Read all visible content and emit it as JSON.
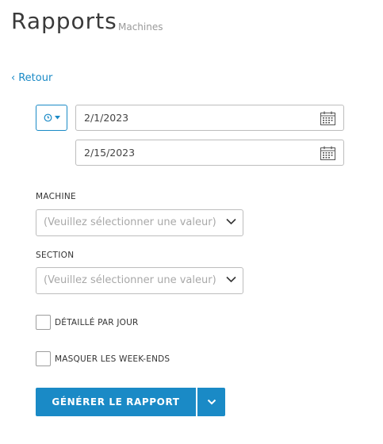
{
  "header": {
    "title": "Rapports",
    "subtitle": "Machines"
  },
  "nav": {
    "back_label": "Retour"
  },
  "date_range": {
    "start_date": "2/1/2023",
    "end_date": "2/15/2023"
  },
  "machine": {
    "label": "MACHINE",
    "placeholder": "(Veuillez sélectionner une valeur)"
  },
  "section": {
    "label": "SECTION",
    "placeholder": "(Veuillez sélectionner une valeur)"
  },
  "options": {
    "detail_by_day_label": "DÉTAILLÉ PAR JOUR",
    "hide_weekends_label": "MASQUER LES WEEK-ENDS"
  },
  "actions": {
    "generate_label": "GÉNÉRER LE RAPPORT"
  },
  "colors": {
    "accent": "#1a8ac6",
    "border": "#bdbdbd",
    "placeholder": "#a8a8a8"
  }
}
